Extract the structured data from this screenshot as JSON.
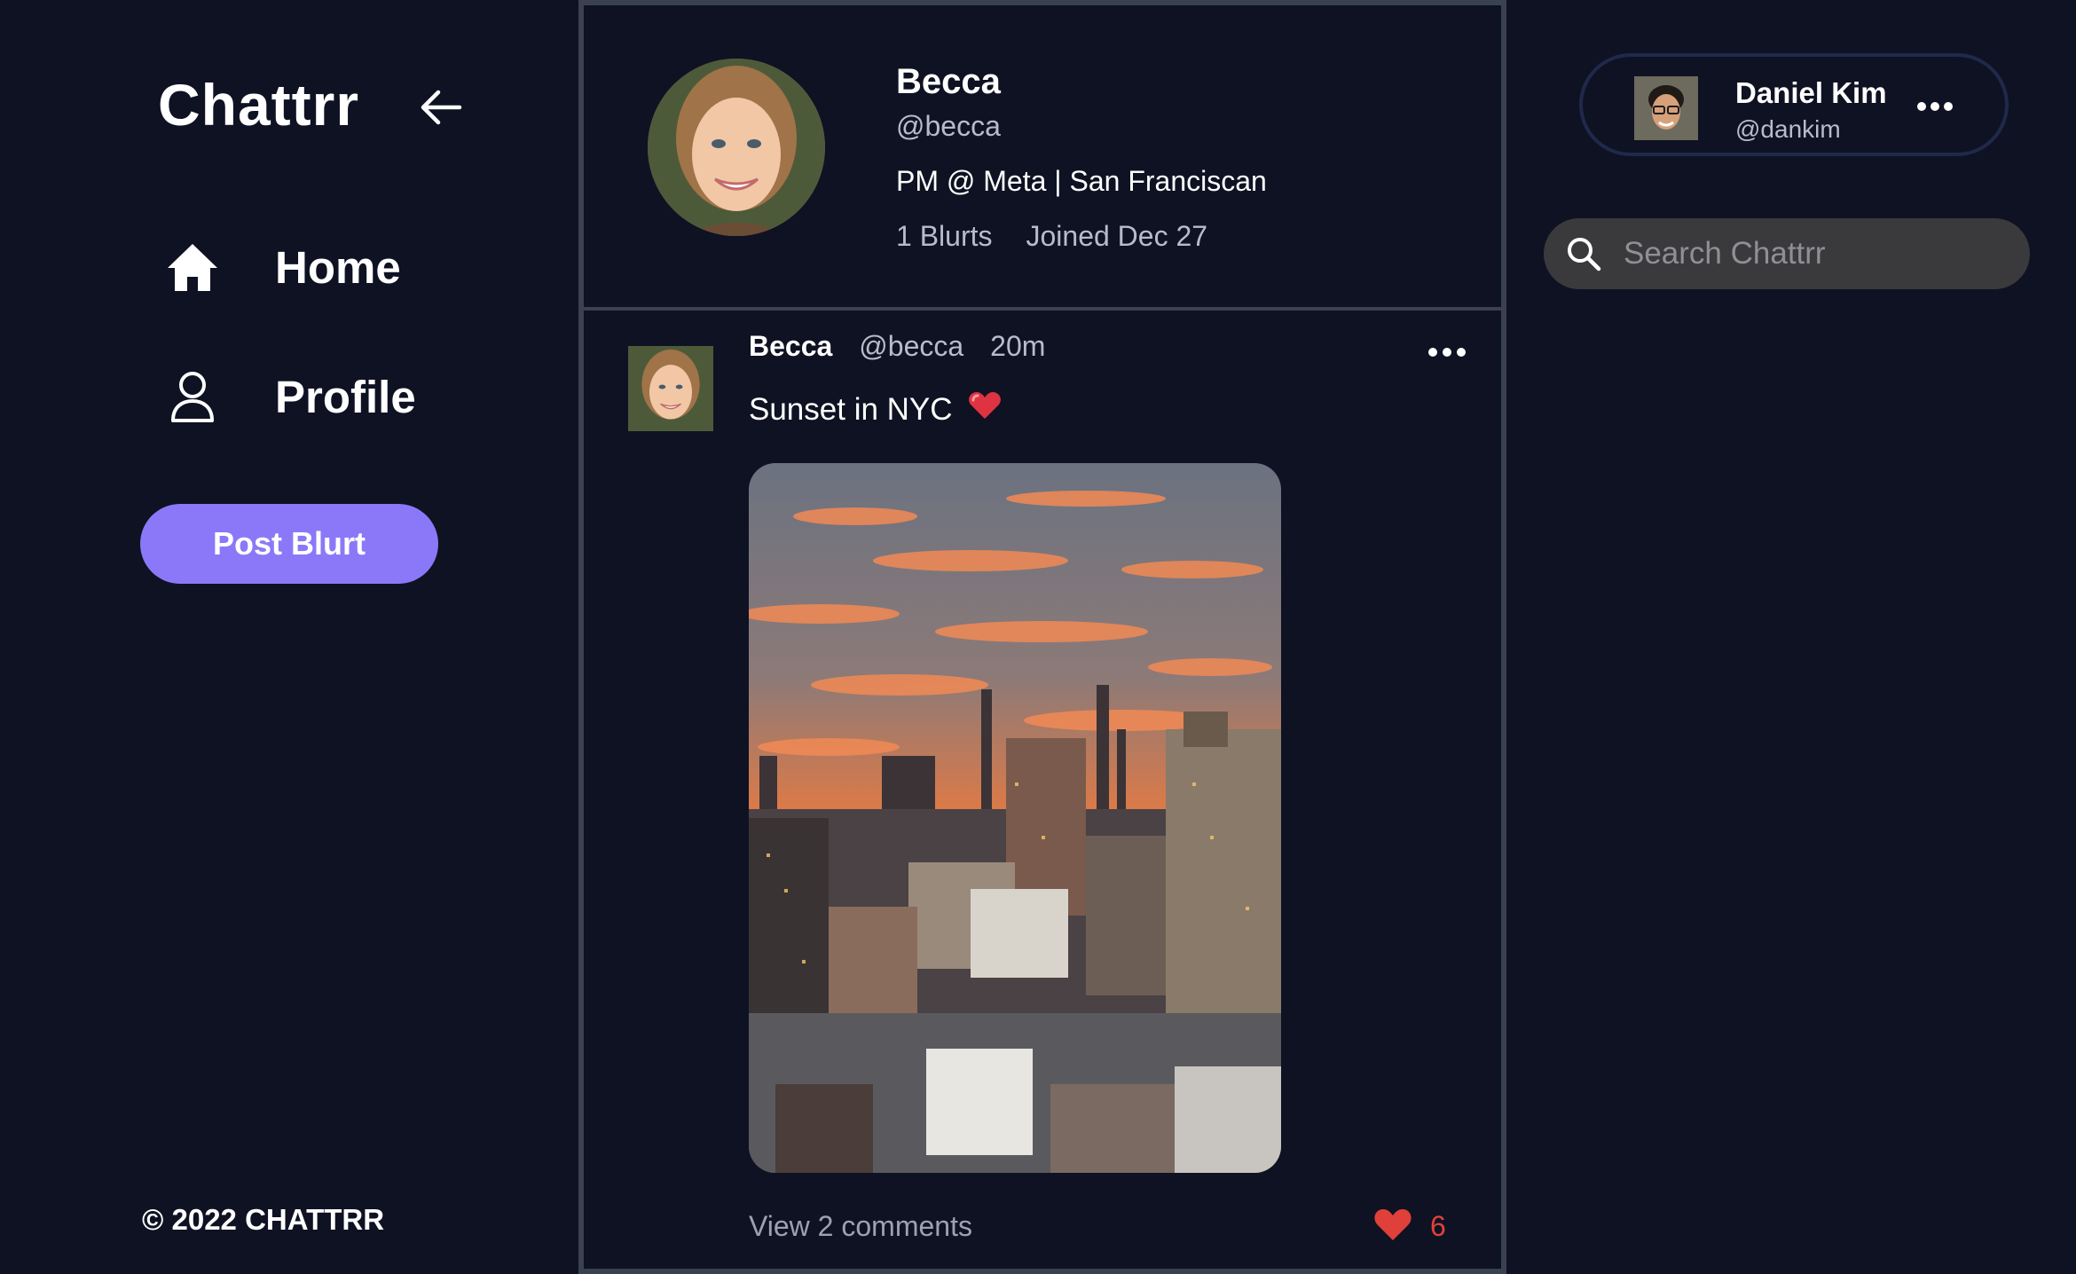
{
  "app": {
    "brand": "Chattrr",
    "copyright": "© 2022 CHATTRR"
  },
  "sidebar": {
    "items": [
      {
        "label": "Home",
        "icon": "home-icon"
      },
      {
        "label": "Profile",
        "icon": "user-icon"
      }
    ],
    "post_button": "Post Blurt"
  },
  "profile": {
    "name": "Becca",
    "handle": "@becca",
    "bio": "PM @ Meta | San Franciscan",
    "blurts": "1 Blurts",
    "joined": "Joined Dec 27"
  },
  "post": {
    "author": "Becca",
    "handle": "@becca",
    "time": "20m",
    "text": "Sunset in NYC",
    "emoji": "heart-emoji",
    "comments_label": "View 2 comments",
    "likes": "6"
  },
  "current_user": {
    "name": "Daniel Kim",
    "handle": "@dankim"
  },
  "search": {
    "placeholder": "Search Chattrr"
  },
  "colors": {
    "background": "#0e1223",
    "accent": "#8b78f8",
    "divider": "#3a4150",
    "like": "#e0403a",
    "search_bg": "#3a3a3d"
  }
}
